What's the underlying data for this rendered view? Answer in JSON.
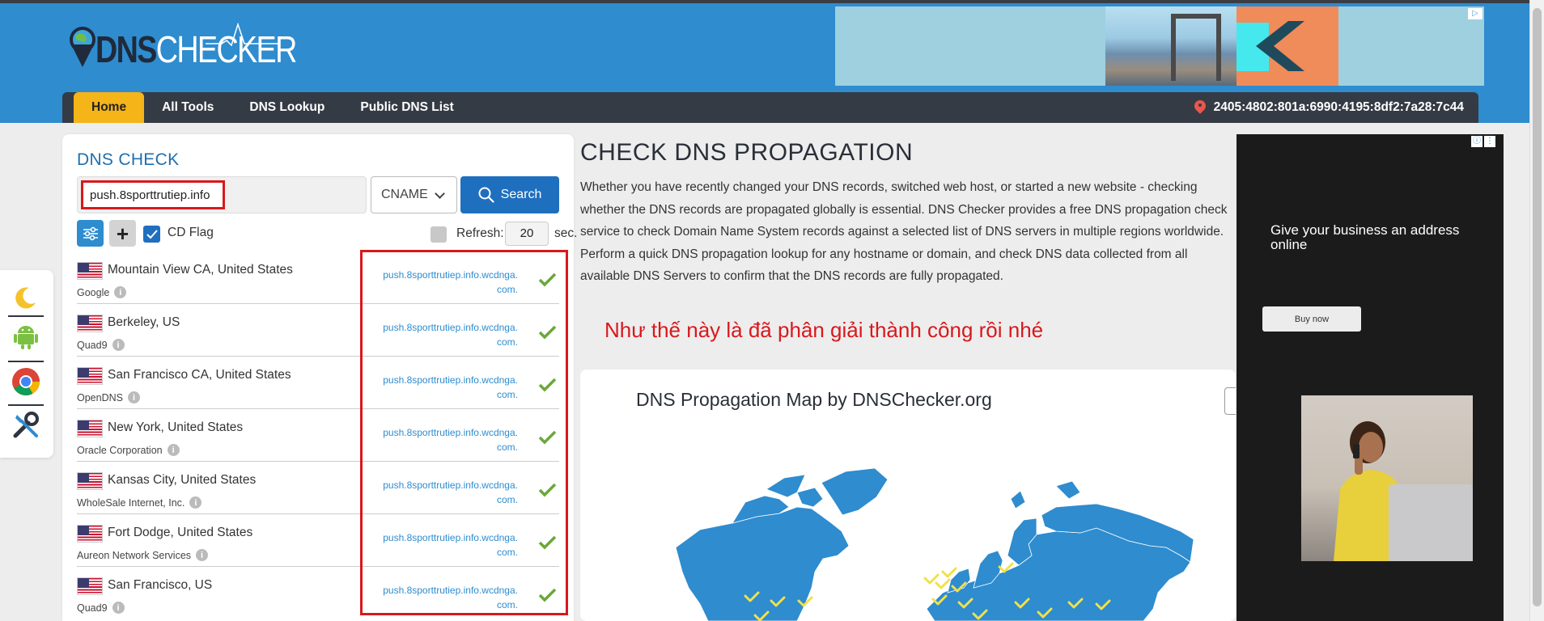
{
  "header": {
    "logo_dns": "DNS",
    "logo_checker": "CHECKER",
    "ad_icon": "adchoices-icon"
  },
  "nav": {
    "items": [
      {
        "label": "Home",
        "active": true
      },
      {
        "label": "All Tools",
        "active": false
      },
      {
        "label": "DNS Lookup",
        "active": false
      },
      {
        "label": "Public DNS List",
        "active": false
      }
    ],
    "ip": "2405:4802:801a:6990:4195:8df2:7a28:7c44",
    "ip_icon": "location-pin-icon"
  },
  "side_tools": [
    {
      "icon": "moon-icon"
    },
    {
      "icon": "android-icon"
    },
    {
      "icon": "chrome-icon"
    },
    {
      "icon": "tools-icon"
    }
  ],
  "dns_check": {
    "title": "DNS CHECK",
    "domain_value": "push.8sporttrutiep.info",
    "record_type": "CNAME",
    "search_label": "Search",
    "cd_flag_label": "CD Flag",
    "cd_flag_checked": true,
    "refresh_label": "Refresh:",
    "refresh_value": "20",
    "refresh_unit": "sec."
  },
  "results": [
    {
      "location": "Mountain View CA, United States",
      "provider": "Google",
      "value_line1": "push.8sporttrutiep.info.wcdnga.",
      "value_line2": "com.",
      "status": "ok"
    },
    {
      "location": "Berkeley, US",
      "provider": "Quad9",
      "value_line1": "push.8sporttrutiep.info.wcdnga.",
      "value_line2": "com.",
      "status": "ok"
    },
    {
      "location": "San Francisco CA, United States",
      "provider": "OpenDNS",
      "value_line1": "push.8sporttrutiep.info.wcdnga.",
      "value_line2": "com.",
      "status": "ok"
    },
    {
      "location": "New York, United States",
      "provider": "Oracle Corporation",
      "value_line1": "push.8sporttrutiep.info.wcdnga.",
      "value_line2": "com.",
      "status": "ok"
    },
    {
      "location": "Kansas City, United States",
      "provider": "WholeSale Internet, Inc.",
      "value_line1": "push.8sporttrutiep.info.wcdnga.",
      "value_line2": "com.",
      "status": "ok"
    },
    {
      "location": "Fort Dodge, United States",
      "provider": "Aureon Network Services",
      "value_line1": "push.8sporttrutiep.info.wcdnga.",
      "value_line2": "com.",
      "status": "ok"
    },
    {
      "location": "San Francisco, US",
      "provider": "Quad9",
      "value_line1": "push.8sporttrutiep.info.wcdnga.",
      "value_line2": "com.",
      "status": "ok"
    }
  ],
  "main": {
    "title": "CHECK DNS PROPAGATION",
    "description": "Whether you have recently changed your DNS records, switched web host, or started a new website - checking whether the DNS records are propagated globally is essential. DNS Checker provides a free DNS propagation check service to check Domain Name System records against a selected list of DNS servers in multiple regions worldwide. Perform a quick DNS propagation lookup for any hostname or domain, and check DNS data collected from all available DNS Servers to confirm that the DNS records are fully propagated.",
    "note": "Như thế này là đã phân giải thành công rồi nhé",
    "map_title": "DNS Propagation Map by DNSChecker.org"
  },
  "side_ad": {
    "headline": "Give your business an address online",
    "button": "Buy now"
  },
  "colors": {
    "header_blue": "#2e8ccf",
    "nav_dark": "#353b45",
    "active_tab": "#f5b417",
    "highlight_red": "#d9181c",
    "check_green": "#6aa83a"
  }
}
